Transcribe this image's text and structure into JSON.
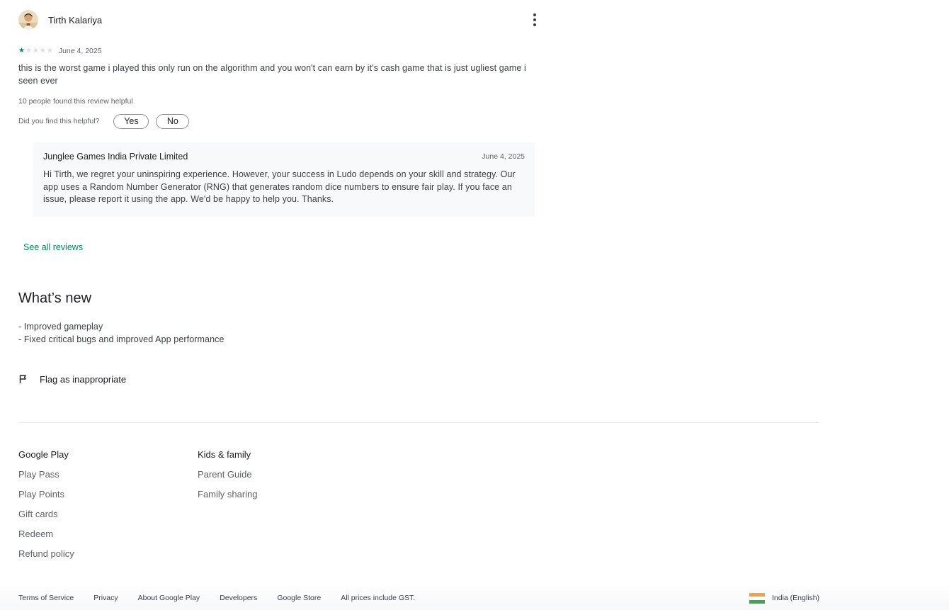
{
  "review": {
    "author": "Tirth Kalariya",
    "rating": 1,
    "max_rating": 5,
    "date": "June 4, 2025",
    "text": "this is the worst game i played this only run on the algorithm and you won't can earn by it's cash game that is just ugliest game i seen ever",
    "helpful_count_text": "10 people found this review helpful",
    "helpful_question": "Did you find this helpful?",
    "yes_label": "Yes",
    "no_label": "No",
    "icons": {
      "avatar": "avatar-photo",
      "more": "more-vert-icon"
    }
  },
  "developer_reply": {
    "developer": "Junglee Games India Private Limited",
    "date": "June 4, 2025",
    "text": "Hi Tirth, we regret your uninspiring experience. However, your success in Ludo depends on your skill and strategy. Our app uses a Random Number Generator (RNG) that generates random dice numbers to ensure fair play. If you face an issue, please report it using the app. We'd be happy to help you. Thanks."
  },
  "see_all_reviews": "See all reviews",
  "whats_new": {
    "title": "What’s new",
    "line1": "- Improved gameplay",
    "line2": "- Fixed critical bugs and improved App performance"
  },
  "flag": {
    "label": "Flag as inappropriate",
    "icon": "flag-icon"
  },
  "footer": {
    "col1": {
      "title": "Google Play",
      "links": [
        "Play Pass",
        "Play Points",
        "Gift cards",
        "Redeem",
        "Refund policy"
      ]
    },
    "col2": {
      "title": "Kids & family",
      "links": [
        "Parent Guide",
        "Family sharing"
      ]
    }
  },
  "bottom_bar": {
    "links": [
      "Terms of Service",
      "Privacy",
      "About Google Play",
      "Developers",
      "Google Store"
    ],
    "note": "All prices include GST.",
    "locale": "India (English)",
    "locale_icon": "india-flag-icon"
  },
  "colors": {
    "accent": "#01875f",
    "text_primary": "#202124",
    "text_secondary": "#5f6368",
    "reply_background": "#f8f9fa"
  }
}
